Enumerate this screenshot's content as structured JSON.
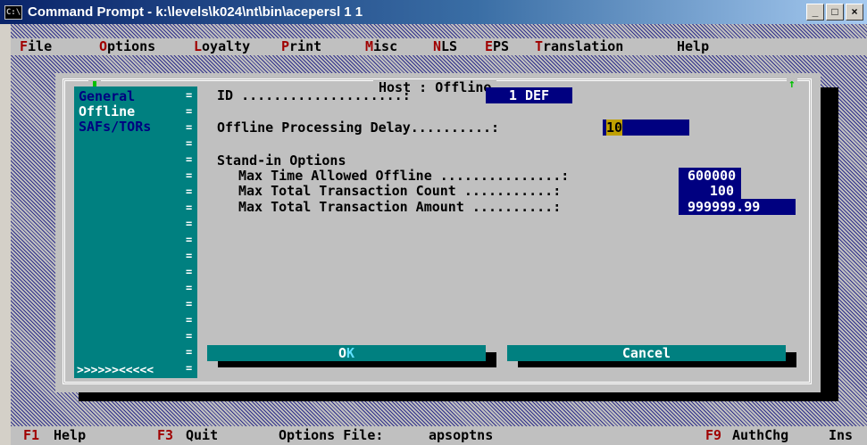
{
  "window": {
    "title": "Command Prompt - k:\\levels\\k024\\nt\\bin\\acepersl 1 1",
    "icon_name": "console-icon",
    "buttons": [
      "_",
      "□",
      "×"
    ]
  },
  "menu": [
    {
      "hot": "F",
      "rest": "ile"
    },
    {
      "hot": "O",
      "rest": "ptions"
    },
    {
      "hot": "L",
      "rest": "oyalty"
    },
    {
      "hot": "P",
      "rest": "rint"
    },
    {
      "hot": "M",
      "rest": "isc"
    },
    {
      "hot": "N",
      "rest": "LS"
    },
    {
      "hot": "E",
      "rest": "PS"
    },
    {
      "hot": "T",
      "rest": "ranslation"
    },
    {
      "hot": "",
      "rest": "Help"
    }
  ],
  "dialog": {
    "title": "Host : Offline",
    "sidebar": {
      "items": [
        "General",
        "Offline",
        "SAFs/TORs"
      ],
      "scroll": ">>>>>><<<<<"
    },
    "id_label": "ID ....................: ",
    "id_value": "1 DEF",
    "delay_label": "Offline Processing Delay..........: ",
    "delay_value": "10",
    "standin_heading": "Stand-in Options",
    "standin": [
      {
        "label": "Max Time Allowed Offline ...............:",
        "value": "600000"
      },
      {
        "label": "Max Total Transaction Count ...........:",
        "value": "100"
      },
      {
        "label": "Max Total Transaction Amount ..........:",
        "value": "999999.99"
      }
    ],
    "ok_label": {
      "pre": "O",
      "hot": "K"
    },
    "cancel_label": "Cancel"
  },
  "status": {
    "f1_key": "F1",
    "f1_label": "Help",
    "f3_key": "F3",
    "f3_label": "Quit",
    "options_file_label": "Options File:",
    "options_file_value": "apsoptns",
    "f9_key": "F9",
    "f9_label": "AuthChg",
    "ins": "Ins"
  },
  "colors": {
    "teal": "#008080",
    "field_bg": "#000080",
    "hotkey": "#a00000"
  }
}
